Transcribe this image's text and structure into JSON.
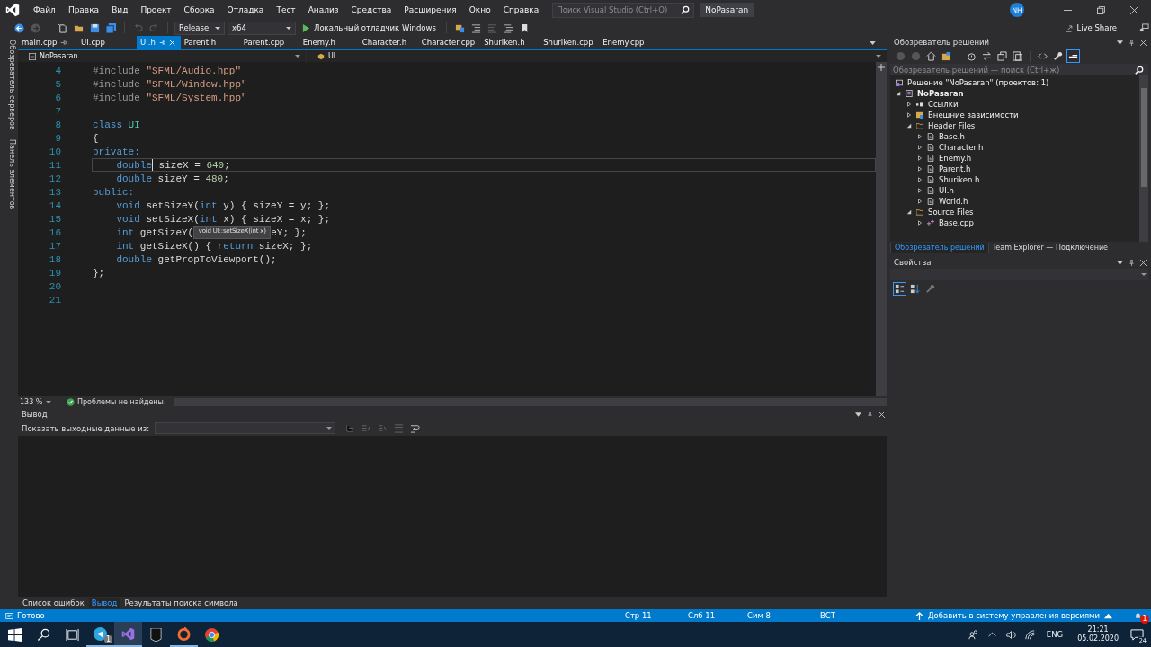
{
  "menu": [
    "Файл",
    "Правка",
    "Вид",
    "Проект",
    "Сборка",
    "Отладка",
    "Тест",
    "Анализ",
    "Средства",
    "Расширения",
    "Окно",
    "Справка"
  ],
  "search": {
    "placeholder": "Поиск Visual Studio (Ctrl+Q)"
  },
  "window": {
    "title": "NoPasaran",
    "avatar": "NH"
  },
  "toolbar": {
    "configuration": "Release",
    "platform": "x64",
    "run": "Локальный отладчик Windows",
    "live_share": "Live Share"
  },
  "side_strip": [
    "Обозреватель серверов",
    "Панель элементов"
  ],
  "tabs": [
    {
      "label": "main.cpp",
      "selected": false,
      "pinned": true
    },
    {
      "label": "UI.cpp",
      "selected": false,
      "pinned": false
    },
    {
      "label": "UI.h",
      "selected": true,
      "pinned": true
    },
    {
      "label": "Parent.h",
      "selected": false,
      "pinned": false
    },
    {
      "label": "Parent.cpp",
      "selected": false,
      "pinned": false
    },
    {
      "label": "Enemy.h",
      "selected": false,
      "pinned": false
    },
    {
      "label": "Character.h",
      "selected": false,
      "pinned": false
    },
    {
      "label": "Character.cpp",
      "selected": false,
      "pinned": false
    },
    {
      "label": "Shuriken.h",
      "selected": false,
      "pinned": false
    },
    {
      "label": "Shuriken.cpp",
      "selected": false,
      "pinned": false
    },
    {
      "label": "Enemy.cpp",
      "selected": false,
      "pinned": false
    }
  ],
  "nav": {
    "project": "NoPasaran",
    "scope": "UI"
  },
  "code": [
    {
      "number": "4",
      "current": false,
      "indented": false,
      "tokens": [
        {
          "kind": "pp",
          "text": "#include "
        },
        {
          "kind": "str",
          "text": "\"SFML/Audio.hpp\""
        }
      ]
    },
    {
      "number": "5",
      "current": false,
      "indented": false,
      "tokens": [
        {
          "kind": "pp",
          "text": "#include "
        },
        {
          "kind": "str",
          "text": "\"SFML/Window.hpp\""
        }
      ]
    },
    {
      "number": "6",
      "current": false,
      "indented": false,
      "tokens": [
        {
          "kind": "pp",
          "text": "#include "
        },
        {
          "kind": "str",
          "text": "\"SFML/System.hpp\""
        }
      ]
    },
    {
      "number": "7",
      "current": false
    },
    {
      "number": "8",
      "current": false,
      "indented": false,
      "tokens": [
        {
          "kind": "kw",
          "text": "class "
        },
        {
          "kind": "type",
          "text": "UI"
        }
      ]
    },
    {
      "number": "9",
      "current": false,
      "indented": false,
      "tokens": [
        {
          "kind": "plain",
          "text": "{"
        }
      ]
    },
    {
      "number": "10",
      "current": false,
      "indented": false,
      "tokens": [
        {
          "kind": "kw",
          "text": "private:"
        }
      ]
    },
    {
      "number": "11",
      "current": true,
      "indented": true,
      "tokens": [
        {
          "kind": "kw",
          "text": "double",
          "caret_after": true
        },
        {
          "kind": "plain",
          "text": " sizeX = "
        },
        {
          "kind": "num",
          "text": "640"
        },
        {
          "kind": "plain",
          "text": ";"
        }
      ]
    },
    {
      "number": "12",
      "current": false,
      "indented": true,
      "tokens": [
        {
          "kind": "kw",
          "text": "double"
        },
        {
          "kind": "plain",
          "text": " sizeY = "
        },
        {
          "kind": "num",
          "text": "480"
        },
        {
          "kind": "plain",
          "text": ";"
        }
      ]
    },
    {
      "number": "13",
      "current": false,
      "indented": false,
      "tokens": [
        {
          "kind": "kw",
          "text": "public:"
        }
      ]
    },
    {
      "number": "14",
      "current": false,
      "indented": true,
      "tokens": [
        {
          "kind": "kw",
          "text": "void"
        },
        {
          "kind": "plain",
          "text": " setSizeY("
        },
        {
          "kind": "kw",
          "text": "int"
        },
        {
          "kind": "plain",
          "text": " y) { sizeY = y; };"
        }
      ]
    },
    {
      "number": "15",
      "current": false,
      "indented": true,
      "tokens": [
        {
          "kind": "kw",
          "text": "void"
        },
        {
          "kind": "plain",
          "text": " setSizeX("
        },
        {
          "kind": "kw",
          "text": "int"
        },
        {
          "kind": "plain",
          "text": " x) { sizeX = x; };"
        }
      ]
    },
    {
      "number": "16",
      "current": false,
      "indented": true,
      "tokens": [
        {
          "kind": "kw",
          "text": "int"
        },
        {
          "kind": "plain",
          "text": " getSizeY("
        },
        {
          "kind": "tooltip",
          "text": "void UI::setSizeX(int x)"
        },
        {
          "kind": "plain",
          "text": "eY; };"
        }
      ]
    },
    {
      "number": "17",
      "current": false,
      "indented": true,
      "tokens": [
        {
          "kind": "kw",
          "text": "int"
        },
        {
          "kind": "plain",
          "text": " getSizeX() { "
        },
        {
          "kind": "kw",
          "text": "return"
        },
        {
          "kind": "plain",
          "text": " sizeX; };"
        }
      ]
    },
    {
      "number": "18",
      "current": false,
      "indented": true,
      "tokens": [
        {
          "kind": "kw",
          "text": "double"
        },
        {
          "kind": "plain",
          "text": " getPropToViewport();"
        }
      ]
    },
    {
      "number": "19",
      "current": false,
      "indented": false,
      "tokens": [
        {
          "kind": "plain",
          "text": "};"
        }
      ]
    },
    {
      "number": "20",
      "current": false
    },
    {
      "number": "21",
      "current": false
    }
  ],
  "editor_status": {
    "zoom": "133 %",
    "problems": "Проблемы не найдены."
  },
  "output": {
    "title": "Вывод",
    "source_label": "Показать выходные данные из:"
  },
  "bottom_tabs": [
    {
      "label": "Список ошибок",
      "selected": false
    },
    {
      "label": "Вывод",
      "selected": true
    },
    {
      "label": "Результаты поиска символа",
      "selected": false
    }
  ],
  "solution_explorer": {
    "title": "Обозреватель решений",
    "search_placeholder": "Обозреватель решений — поиск (Ctrl+ж)",
    "tree": [
      {
        "label": "Решение \"NoPasaran\"  (проектов: 1)",
        "kind": "solution",
        "children": [
          {
            "label": "NoPasaran",
            "kind": "project",
            "expanded": true,
            "children": [
              {
                "label": "Ссылки",
                "kind": "references",
                "expanded": false
              },
              {
                "label": "Внешние зависимости",
                "kind": "external",
                "expanded": false
              },
              {
                "label": "Header Files",
                "kind": "folder",
                "expanded": true,
                "children": [
                  {
                    "label": "Base.h",
                    "kind": "header",
                    "expanded": false
                  },
                  {
                    "label": "Character.h",
                    "kind": "header",
                    "expanded": false
                  },
                  {
                    "label": "Enemy.h",
                    "kind": "header",
                    "expanded": false
                  },
                  {
                    "label": "Parent.h",
                    "kind": "header",
                    "expanded": false
                  },
                  {
                    "label": "Shuriken.h",
                    "kind": "header",
                    "expanded": false
                  },
                  {
                    "label": "UI.h",
                    "kind": "header",
                    "expanded": false
                  },
                  {
                    "label": "World.h",
                    "kind": "header",
                    "expanded": false
                  }
                ]
              },
              {
                "label": "Source Files",
                "kind": "folder",
                "expanded": true,
                "children": [
                  {
                    "label": "Base.cpp",
                    "kind": "source",
                    "expanded": false
                  }
                ]
              }
            ]
          }
        ]
      }
    ],
    "tabs": [
      {
        "label": "Обозреватель решений",
        "selected": true
      },
      {
        "label": "Team Explorer — Подключение",
        "selected": false
      }
    ]
  },
  "properties": {
    "title": "Свойства"
  },
  "status_bar": {
    "ready": "Готово",
    "line": "Стр 11",
    "col": "Слб 11",
    "char": "Сим 8",
    "mode": "ВСТ",
    "source_control": "Добавить в систему управления версиями",
    "notifications": "1"
  },
  "taskbar": {
    "apps": [
      {
        "kind": "telegram",
        "selected": false,
        "running": true,
        "badge": "1"
      },
      {
        "kind": "vs",
        "selected": true,
        "running": true
      },
      {
        "kind": "epic",
        "selected": false,
        "running": false
      },
      {
        "kind": "origin",
        "selected": false,
        "running": true
      },
      {
        "kind": "chrome",
        "selected": false,
        "running": false
      }
    ],
    "language": "ENG",
    "time": "21:21",
    "date": "05.02.2020",
    "notifications": "24"
  }
}
